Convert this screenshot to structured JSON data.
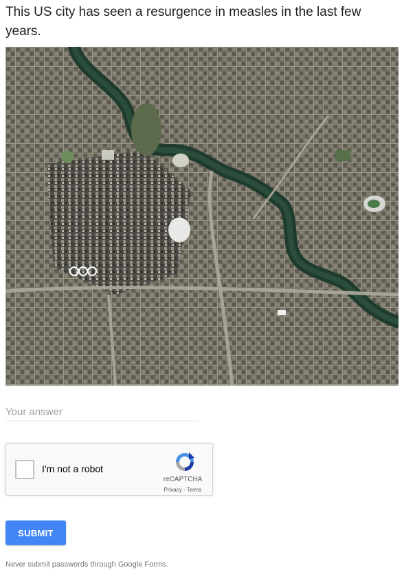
{
  "question": {
    "text": "This US city has seen a resurgence in measles in the last few years."
  },
  "image": {
    "description_icon": "satellite-map-image"
  },
  "answer": {
    "placeholder": "Your answer",
    "value": ""
  },
  "recaptcha": {
    "checkbox_label": "I'm not a robot",
    "brand": "reCAPTCHA",
    "privacy_link": "Privacy",
    "separator": " - ",
    "terms_link": "Terms",
    "logo_icon": "recaptcha-logo-icon"
  },
  "submit": {
    "label": "SUBMIT"
  },
  "footer": {
    "text": "Never submit passwords through Google Forms."
  },
  "colors": {
    "accent": "#4285f4",
    "river": "#1e3a2c"
  }
}
